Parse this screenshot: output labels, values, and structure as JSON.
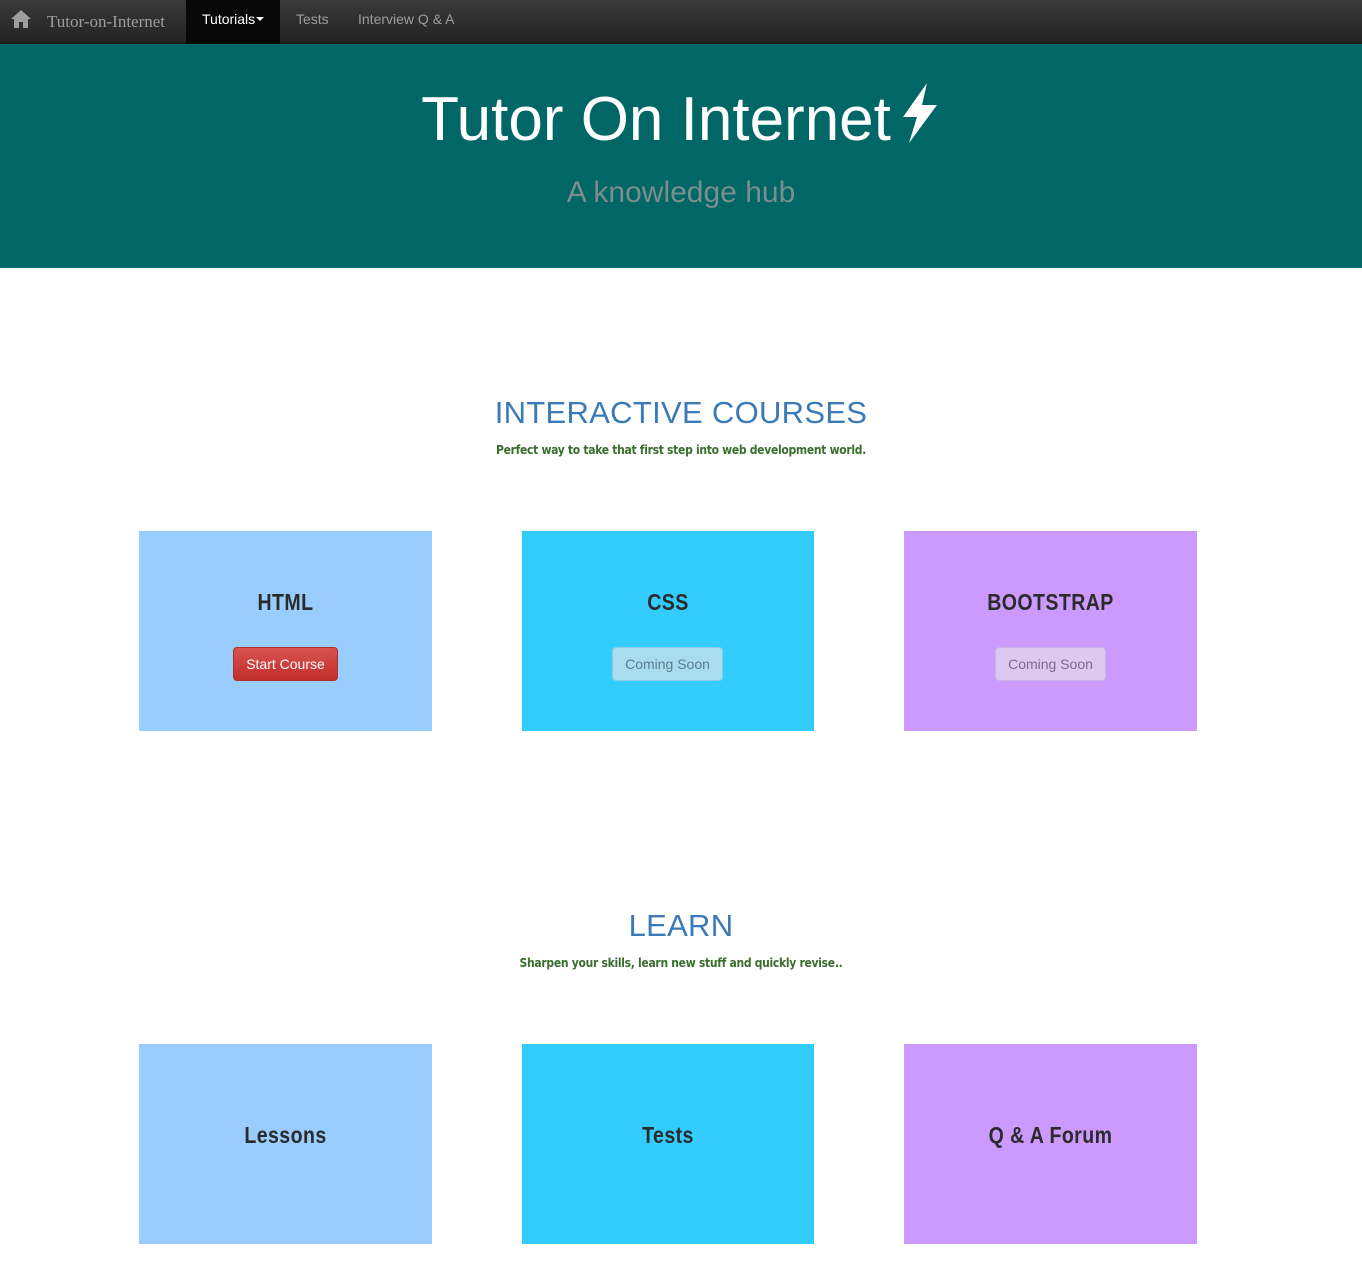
{
  "navbar": {
    "home_icon": "home-icon",
    "brand": "Tutor-on-Internet",
    "items": [
      {
        "label": "Tutorials"
      },
      {
        "label": "Tests"
      },
      {
        "label": "Interview Q & A"
      }
    ]
  },
  "hero": {
    "title": "Tutor On Internet",
    "title_icon": "lightning-bolt-icon",
    "subtitle": "A knowledge hub",
    "background_color": "#006666"
  },
  "courses": {
    "title": "INTERACTIVE COURSES",
    "subtitle": "Perfect way to take that first step into web development world.",
    "cards": [
      {
        "title": "HTML",
        "button": "Start Course",
        "color": "#99ccff"
      },
      {
        "title": "CSS",
        "button": "Coming Soon",
        "color": "#33ccff"
      },
      {
        "title": "BOOTSTRAP",
        "button": "Coming Soon",
        "color": "#cc99ff"
      }
    ]
  },
  "learn": {
    "title": "LEARN",
    "subtitle": "Sharpen your skills, learn new stuff and quickly revise..",
    "cards": [
      {
        "title": "Lessons",
        "color": "#99ccff"
      },
      {
        "title": "Tests",
        "color": "#33ccff"
      },
      {
        "title": "Q & A Forum",
        "color": "#cc99ff"
      }
    ]
  },
  "colors": {
    "section_title": "#3a7ab8",
    "section_subtitle": "#3a6e2e",
    "start_button": "#d9534f"
  }
}
